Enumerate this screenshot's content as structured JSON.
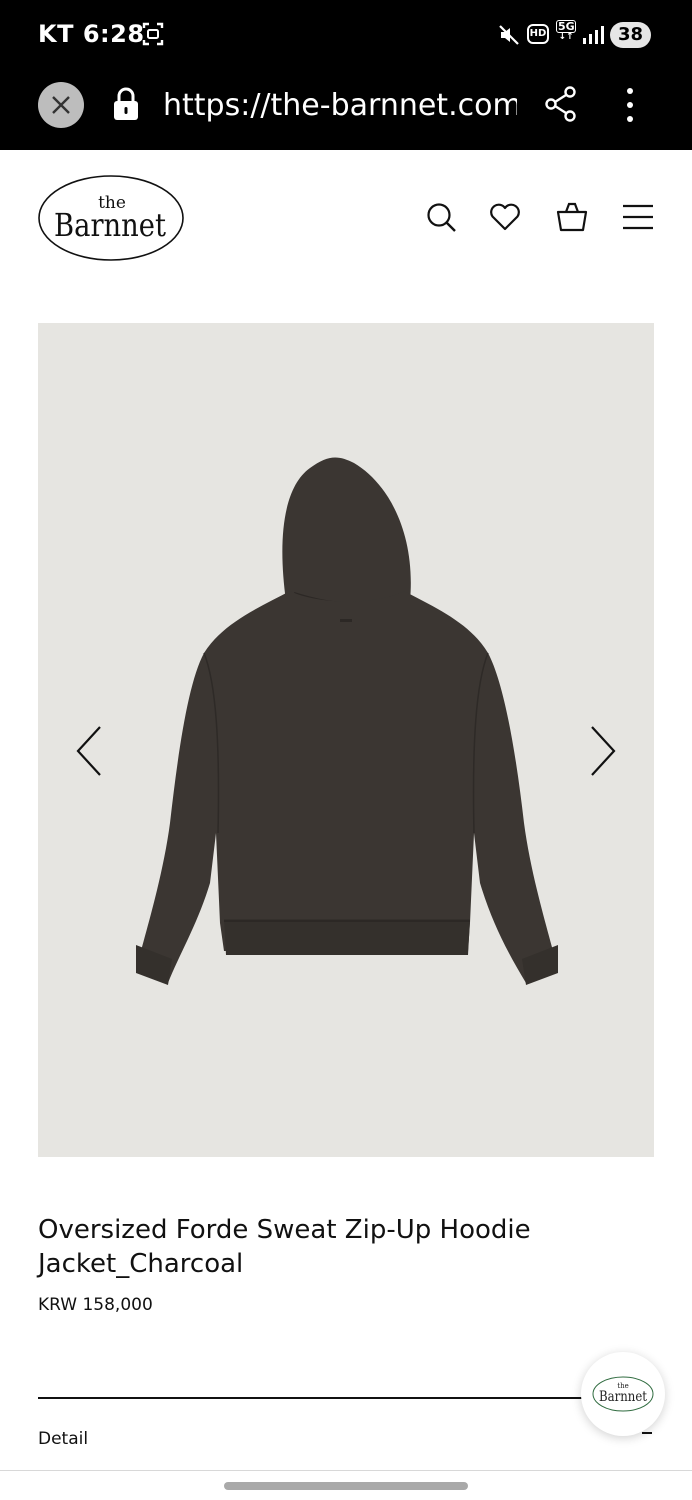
{
  "status_bar": {
    "carrier_time": "KT 6:28",
    "network": "5G",
    "hd": "HD",
    "battery": "38"
  },
  "browser": {
    "url": "https://the-barnnet.com/p"
  },
  "site": {
    "logo_small": "the",
    "logo_main": "Barnnet"
  },
  "product": {
    "title": "Oversized Forde Sweat Zip-Up Hoodie Jacket_Charcoal",
    "price": "KRW 158,000",
    "hoodie_color": "#3b3632",
    "image_bg": "#e6e5e1"
  },
  "sections": {
    "detail_label": "Detail"
  },
  "icons": [
    "screenshot-icon",
    "mute-icon",
    "signal-icon",
    "close-icon",
    "lock-icon",
    "share-icon",
    "more-icon",
    "search-icon",
    "heart-icon",
    "bag-icon",
    "menu-icon",
    "chevron-left-icon",
    "chevron-right-icon"
  ]
}
